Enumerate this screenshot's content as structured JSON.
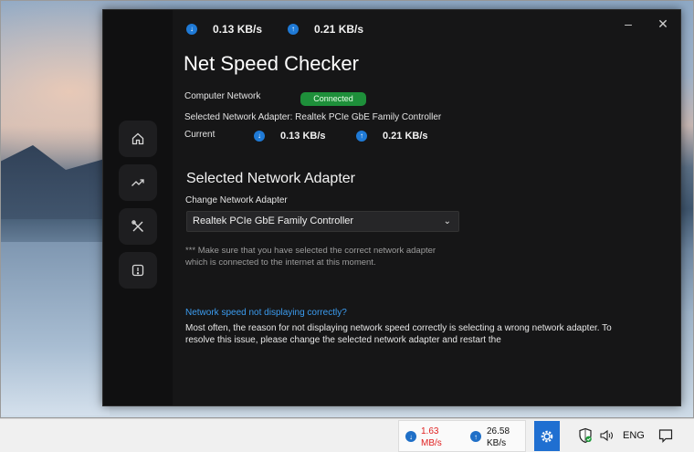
{
  "app": {
    "top_download": "0.13 KB/s",
    "top_upload": "0.21 KB/s",
    "title": "Net Speed Checker",
    "computer_network_label": "Computer Network",
    "status": "Connected",
    "selected_adapter_text": "Selected Network Adapter: Realtek PCIe GbE Family Controller",
    "current_label": "Current",
    "current_download": "0.13 KB/s",
    "current_upload": "0.21 KB/s",
    "section_title": "Selected Network Adapter",
    "change_adapter_label": "Change Network Adapter",
    "adapter_selected": "Realtek PCIe GbE Family Controller",
    "note": "*** Make sure that you have selected the correct network adapter which is connected to the internet at this moment.",
    "help_link": "Network speed not displaying correctly?",
    "help_text": "Most often, the reason for not displaying network speed correctly is selecting a wrong network adapter. To resolve this issue, please change the selected network adapter and restart the",
    "window_controls": {
      "minimize": "–",
      "close": "✕"
    }
  },
  "sidebar": {
    "items": [
      {
        "name": "home",
        "icon": "home-icon"
      },
      {
        "name": "statistics",
        "icon": "trending-up-icon"
      },
      {
        "name": "tools",
        "icon": "tools-icon"
      },
      {
        "name": "about",
        "icon": "info-icon"
      }
    ]
  },
  "taskbar": {
    "download_value": "1.63",
    "download_unit": "MB/s",
    "upload_value": "26.58",
    "upload_unit": "KB/s",
    "language": "ENG",
    "download_color": "#e02020"
  },
  "colors": {
    "accent": "#1f7ad6",
    "connected": "#1e8f3a",
    "link": "#3b9cf0"
  }
}
